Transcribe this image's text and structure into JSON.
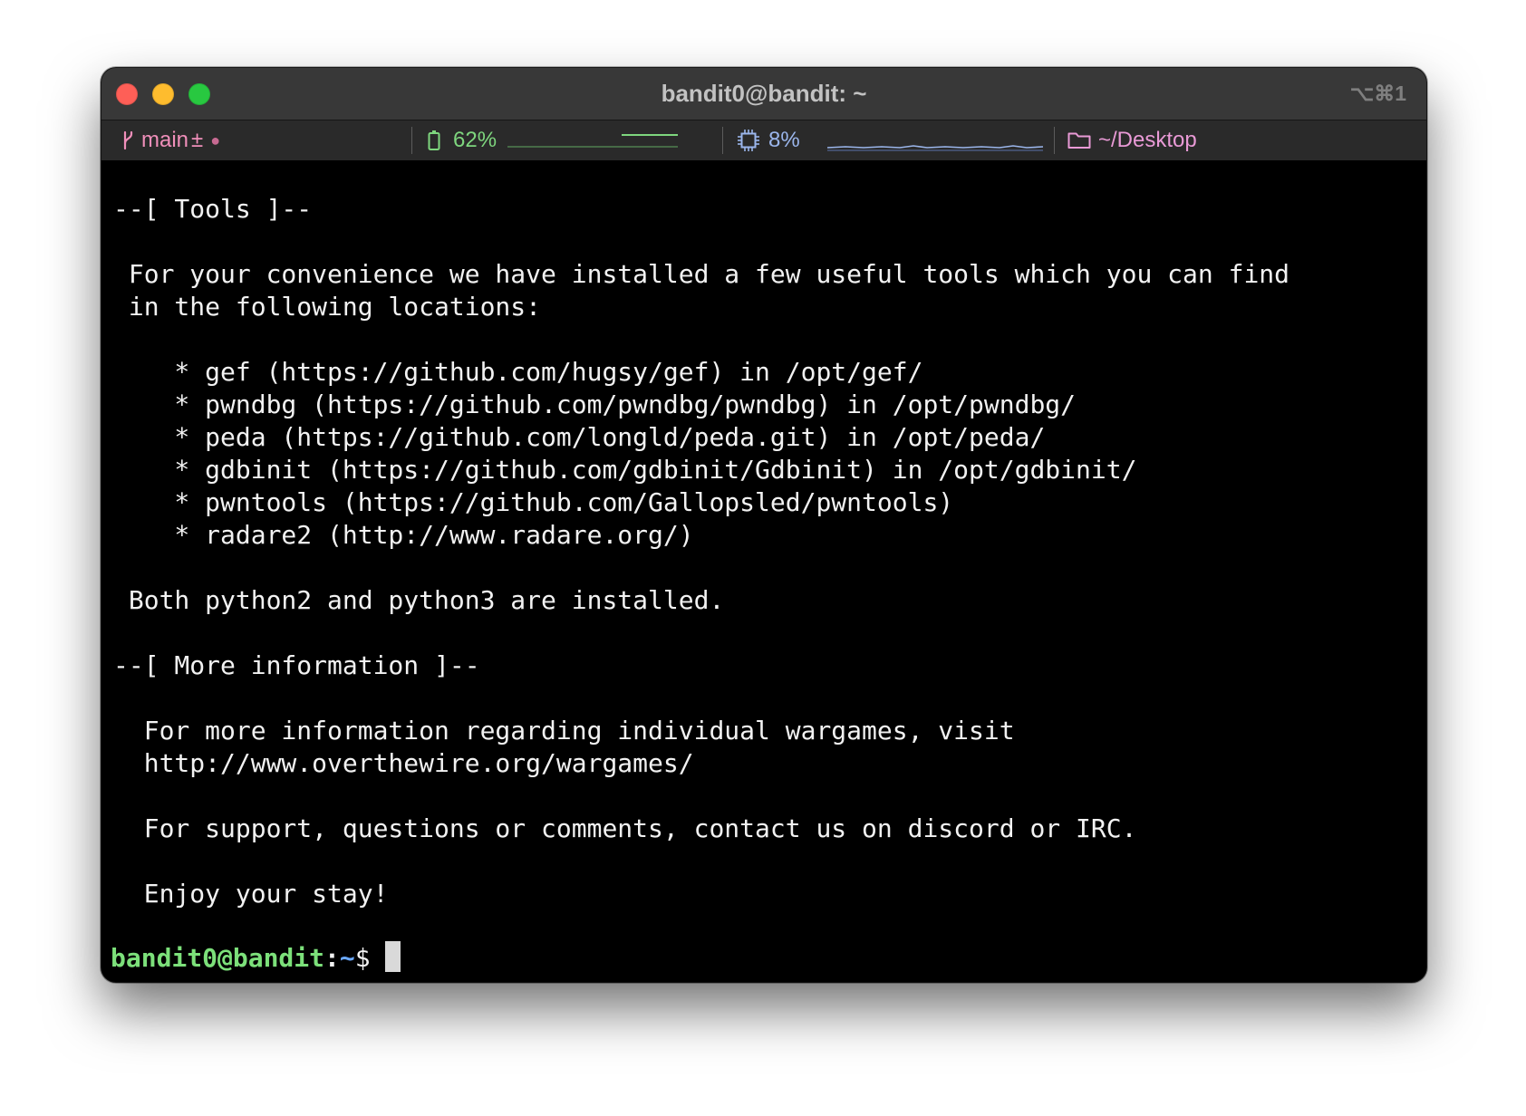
{
  "window": {
    "title": "bandit0@bandit: ~",
    "shortcut": "⌥⌘1",
    "traffic_lights": [
      "close",
      "minimize",
      "zoom"
    ]
  },
  "statusbar": {
    "git": {
      "branch": "main",
      "state": "±",
      "dirty_dot": "●",
      "icon": "branch-icon"
    },
    "battery": {
      "percent": "62%",
      "icon": "battery-icon"
    },
    "cpu": {
      "percent": "8%",
      "icon": "cpu-icon"
    },
    "cwd": {
      "path": "~/Desktop",
      "icon": "folder-icon"
    }
  },
  "colors": {
    "git": "#f08fba",
    "battery": "#7ed67e",
    "cpu": "#9bb6ec",
    "cwd": "#e99ad6",
    "prompt_user": "#7ce07a",
    "prompt_path": "#6aa8ff"
  },
  "terminal": {
    "lines": [
      {
        "text": "--[ Tools ]--"
      },
      {
        "text": " For your convenience we have installed a few useful tools which you can find"
      },
      {
        "text": " in the following locations:"
      },
      {
        "text": "    * gef (https://github.com/hugsy/gef) in /opt/gef/"
      },
      {
        "text": "    * pwndbg (https://github.com/pwndbg/pwndbg) in /opt/pwndbg/"
      },
      {
        "text": "    * peda (https://github.com/longld/peda.git) in /opt/peda/"
      },
      {
        "text": "    * gdbinit (https://github.com/gdbinit/Gdbinit) in /opt/gdbinit/"
      },
      {
        "text": "    * pwntools (https://github.com/Gallopsled/pwntools)"
      },
      {
        "text": "    * radare2 (http://www.radare.org/)"
      },
      {
        "text": " Both python2 and python3 are installed."
      },
      {
        "text": "--[ More information ]--"
      },
      {
        "text": "  For more information regarding individual wargames, visit"
      },
      {
        "text": "  http://www.overthewire.org/wargames/"
      },
      {
        "text": "  For support, questions or comments, contact us on discord or IRC."
      },
      {
        "text": "  Enjoy your stay!"
      }
    ],
    "prompt": {
      "user_host": "bandit0@bandit",
      "separator": ":",
      "path": "~",
      "symbol": "$"
    }
  }
}
